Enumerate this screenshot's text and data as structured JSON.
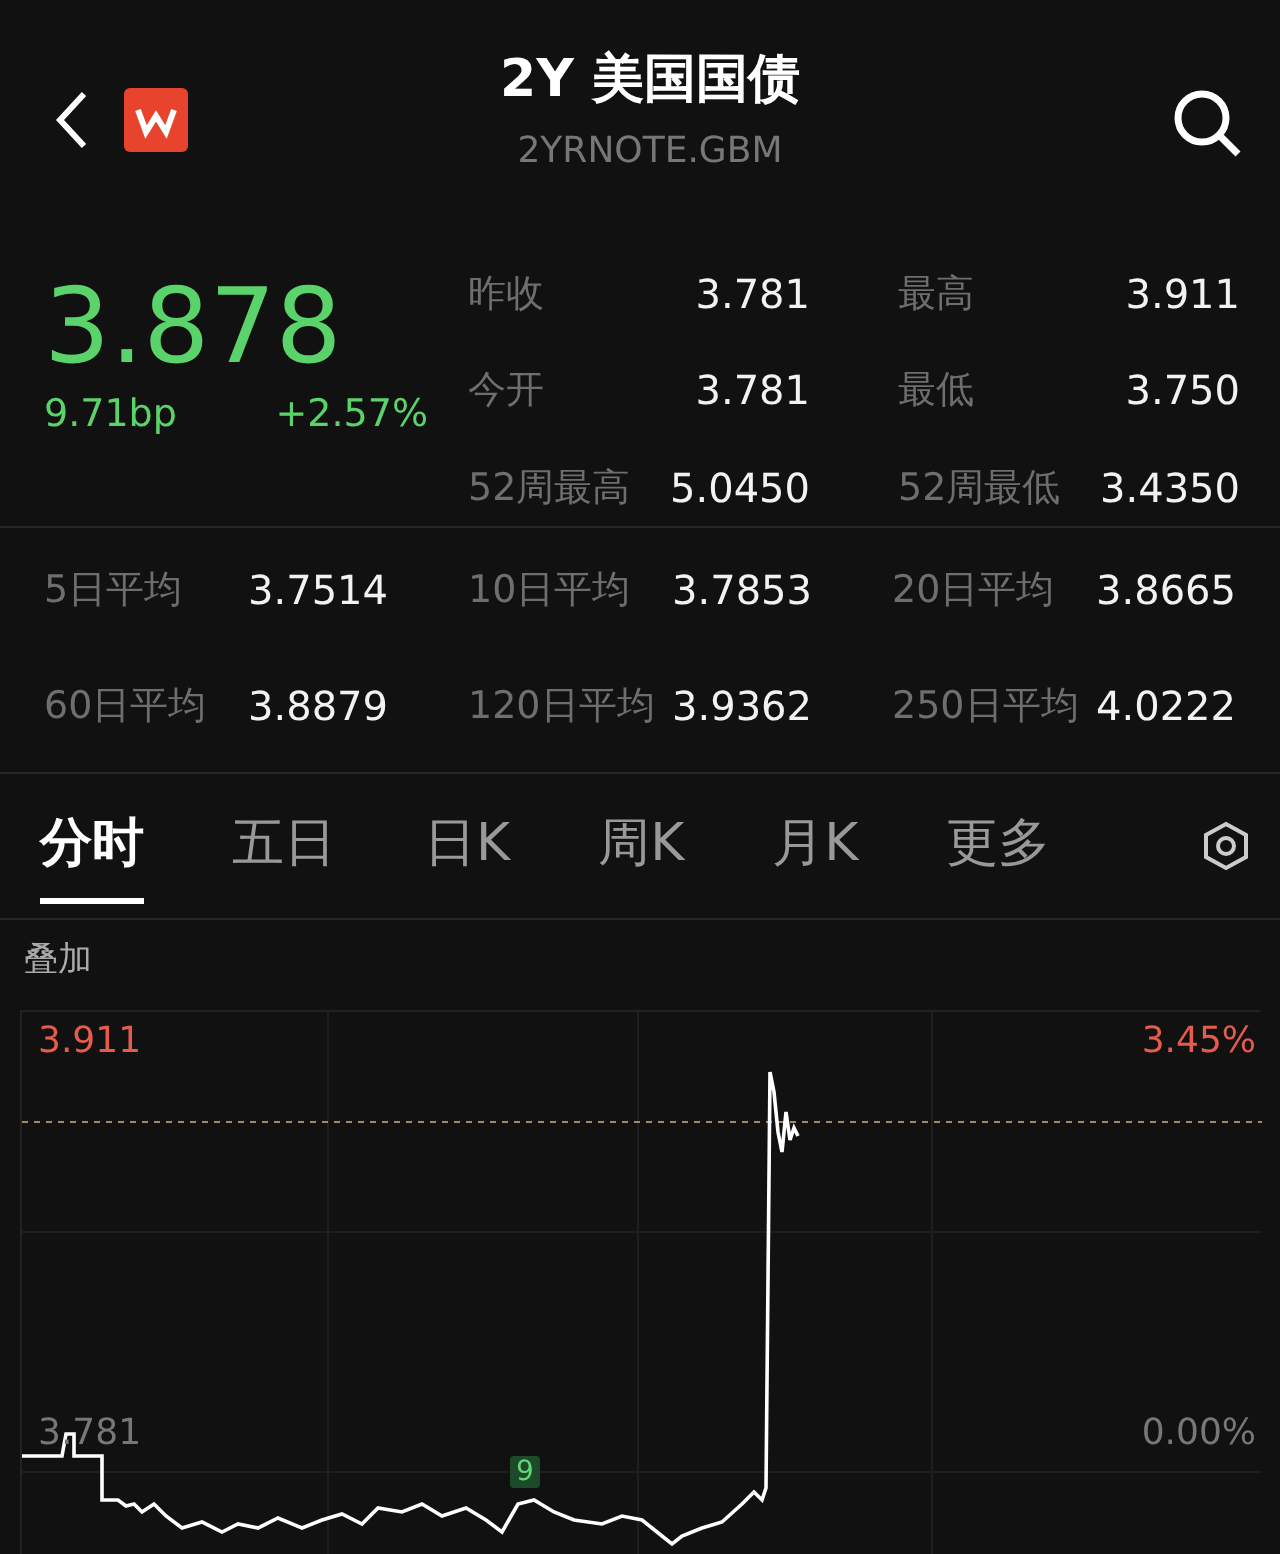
{
  "header": {
    "title": "2Y 美国国债",
    "code": "2YRNOTE.GBM"
  },
  "quote": {
    "price": "3.878",
    "change": "9.71bp",
    "change_pct": "+2.57%",
    "rising": true
  },
  "stats": [
    {
      "label": "昨收",
      "value": "3.781"
    },
    {
      "label": "最高",
      "value": "3.911"
    },
    {
      "label": "今开",
      "value": "3.781"
    },
    {
      "label": "最低",
      "value": "3.750"
    },
    {
      "label": "52周最高",
      "value": "5.0450"
    },
    {
      "label": "52周最低",
      "value": "3.4350"
    }
  ],
  "averages": [
    {
      "label": "5日平均",
      "value": "3.7514"
    },
    {
      "label": "10日平均",
      "value": "3.7853"
    },
    {
      "label": "20日平均",
      "value": "3.8665"
    },
    {
      "label": "60日平均",
      "value": "3.8879"
    },
    {
      "label": "120日平均",
      "value": "3.9362"
    },
    {
      "label": "250日平均",
      "value": "4.0222"
    }
  ],
  "tabs": [
    {
      "label": "分时",
      "selected": true
    },
    {
      "label": "五日",
      "selected": false
    },
    {
      "label": "日K",
      "selected": false
    },
    {
      "label": "周K",
      "selected": false
    },
    {
      "label": "月K",
      "selected": false
    },
    {
      "label": "更多",
      "selected": false
    }
  ],
  "overlay_label": "叠加",
  "chart": {
    "high_price": "3.911",
    "high_pct": "3.45%",
    "base_price": "3.781",
    "base_pct": "0.00%",
    "marker": "9"
  }
}
